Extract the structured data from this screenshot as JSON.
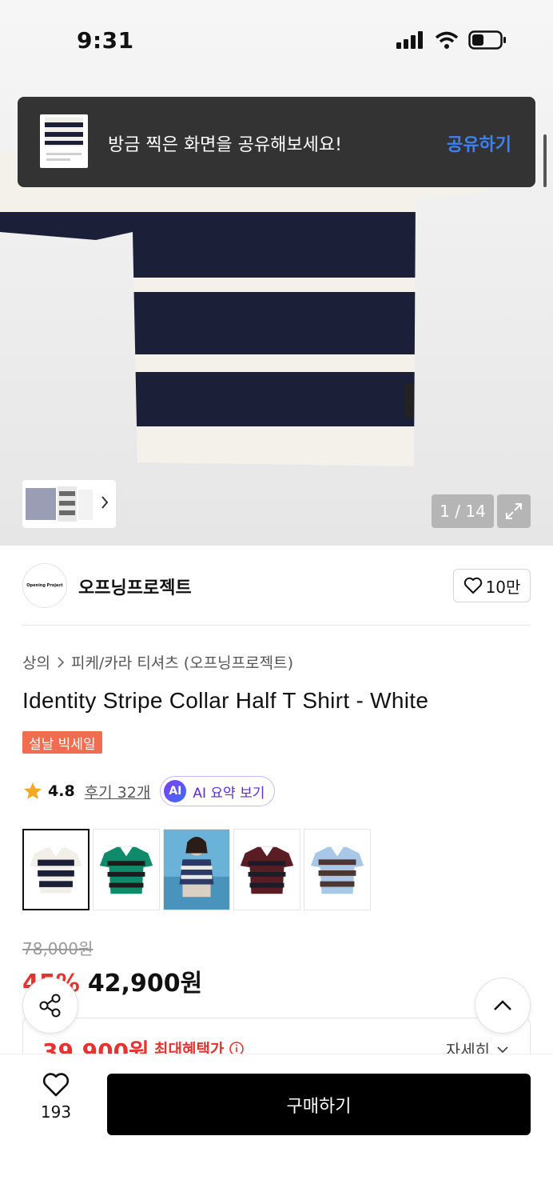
{
  "status_bar": {
    "time": "9:31"
  },
  "toast": {
    "message": "방금 찍은 화면을 공유해보세요!",
    "action": "공유하기"
  },
  "gallery": {
    "counter": "1 / 14",
    "current": 1,
    "total": 14
  },
  "brand": {
    "name": "오프닝프로젝트",
    "logo_text": "Opening Project",
    "like_count": "10만"
  },
  "breadcrumb": {
    "category": "상의",
    "subcategory": "피케/카라 티셔츠 (오프닝프로젝트)"
  },
  "product": {
    "title": "Identity Stripe Collar Half T Shirt - White",
    "sale_badge": "설날 빅세일",
    "rating": "4.8",
    "review_link": "후기 32개",
    "ai_mark": "AI",
    "ai_summary": "AI 요약 보기",
    "variants": [
      {
        "name": "white-navy",
        "colors": [
          "#1b2038",
          "#f1efe8"
        ]
      },
      {
        "name": "green",
        "colors": [
          "#0f8a6a",
          "#1c1c1c"
        ]
      },
      {
        "name": "model-photo",
        "colors": [
          "#2b3a66",
          "#6bb2d8"
        ]
      },
      {
        "name": "burgundy",
        "colors": [
          "#5a1d24",
          "#1c1c28"
        ]
      },
      {
        "name": "sky-brown",
        "colors": [
          "#a9c8e8",
          "#4b3632"
        ]
      }
    ]
  },
  "price": {
    "original": "78,000원",
    "discount": "45%",
    "sale": "42,900원",
    "max_benefit_price": "39,900원",
    "max_benefit_label": "최대혜택가",
    "detail_link": "자세히"
  },
  "bottom_bar": {
    "wish_count": "193",
    "buy_label": "구매하기"
  },
  "colors": {
    "accent_red": "#e3342f",
    "toast_link": "#3b82f6",
    "ai_purple": "#5b2bd6"
  }
}
